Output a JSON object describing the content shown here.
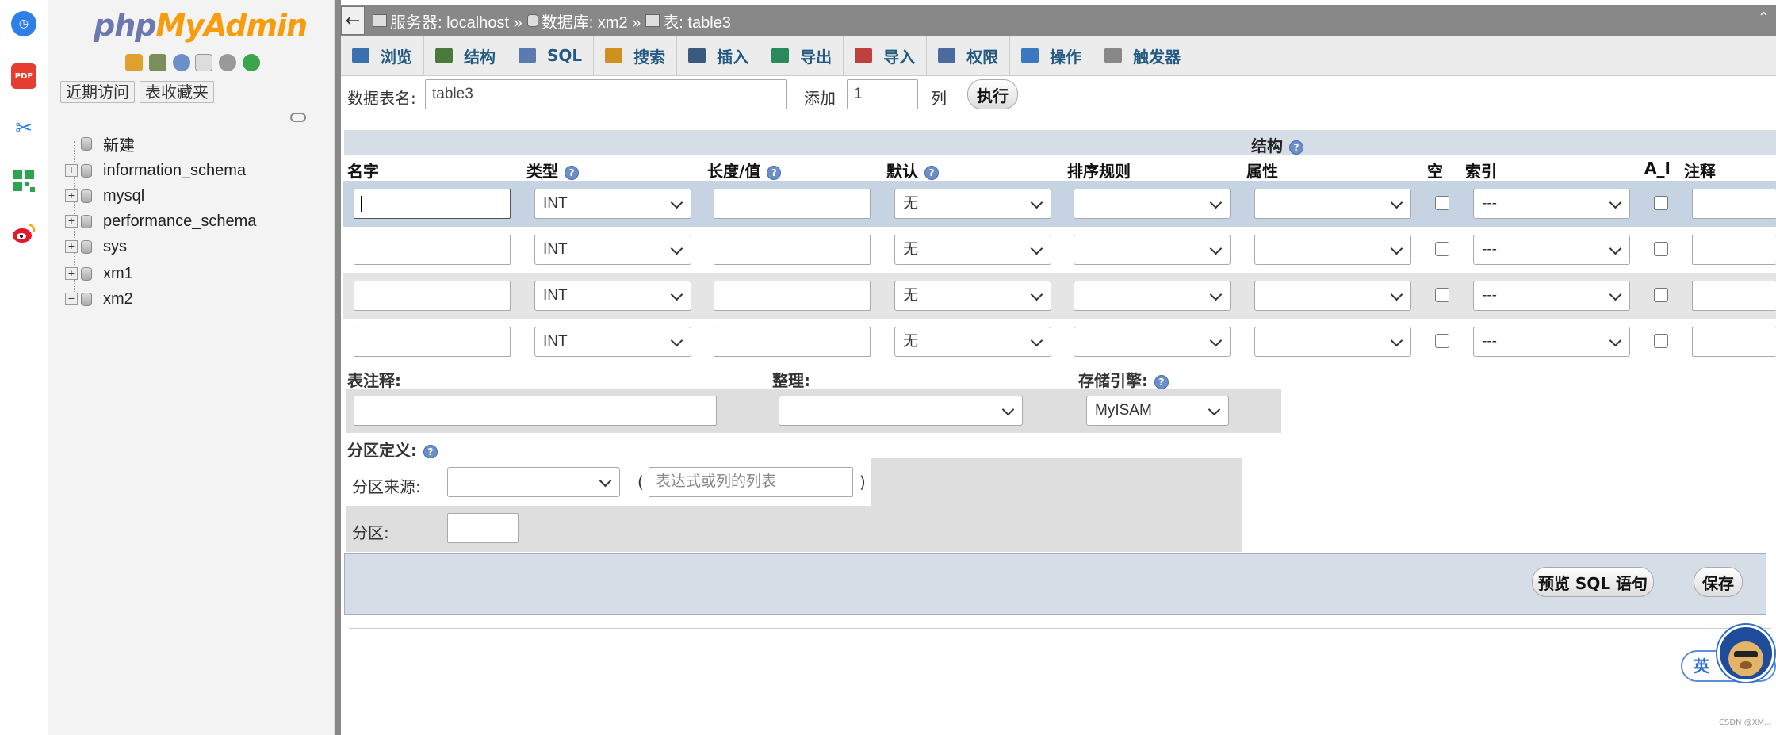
{
  "rail": {
    "items": [
      "clock-icon",
      "pdf-icon",
      "scissors-icon",
      "grid-icon",
      "weibo-icon"
    ],
    "pdf_label": "PDF"
  },
  "nav": {
    "logo_php": "php",
    "logo_myadmin": "MyAdmin",
    "tab_recent": "近期访问",
    "tab_favorites": "表收藏夹",
    "tree": [
      {
        "label": "新建",
        "expander": ""
      },
      {
        "label": "information_schema",
        "expander": "+"
      },
      {
        "label": "mysql",
        "expander": "+"
      },
      {
        "label": "performance_schema",
        "expander": "+"
      },
      {
        "label": "sys",
        "expander": "+"
      },
      {
        "label": "xm1",
        "expander": "+"
      },
      {
        "label": "xm2",
        "expander": "−"
      }
    ]
  },
  "breadcrumb": {
    "back": "←",
    "server": "服务器: localhost »",
    "database": "数据库: xm2 »",
    "table": "表: table3"
  },
  "tabs": [
    "浏览",
    "结构",
    "SQL",
    "搜索",
    "插入",
    "导出",
    "导入",
    "权限",
    "操作",
    "触发器"
  ],
  "form": {
    "table_name_label": "数据表名:",
    "table_name_value": "table3",
    "add_label": "添加",
    "add_value": "1",
    "col_label": "列",
    "go_button": "执行",
    "structure_label": "结构",
    "headers": [
      "名字",
      "类型",
      "长度/值",
      "默认",
      "排序规则",
      "属性",
      "空",
      "索引",
      "A_I",
      "注释"
    ],
    "rows": [
      {
        "type": "INT",
        "default": "无",
        "index": "---"
      },
      {
        "type": "INT",
        "default": "无",
        "index": "---"
      },
      {
        "type": "INT",
        "default": "无",
        "index": "---"
      },
      {
        "type": "INT",
        "default": "无",
        "index": "---"
      }
    ],
    "table_comment_label": "表注释:",
    "collation_label": "整理:",
    "engine_label": "存储引擎:",
    "engine_value": "MyISAM",
    "partition_def_label": "分区定义:",
    "partition_by_label": "分区来源:",
    "paren_open": "(",
    "paren_close": ")",
    "partition_expr_placeholder": "表达式或列的列表",
    "partitions_label": "分区:",
    "preview_sql_button": "预览 SQL 语句",
    "save_button": "保存"
  },
  "overlay": {
    "lang_badge": "英",
    "watermark": "CSDN @XM..."
  },
  "colors": {
    "accent": "#235a81",
    "topbar": "#888888",
    "selected_row": "#c6d3e2",
    "panel": "#dedede"
  }
}
